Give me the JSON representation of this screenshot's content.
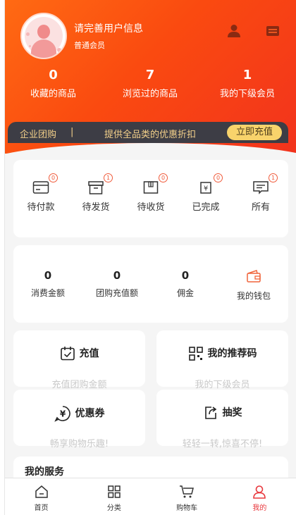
{
  "header": {
    "user_name": "请完善用户信息",
    "member_level": "普通会员",
    "icons": [
      "user-icon",
      "message-icon"
    ],
    "gradient_colors": [
      "#ff6a13",
      "#f2331d"
    ]
  },
  "stats": [
    {
      "value": "0",
      "label": "收藏的商品"
    },
    {
      "value": "7",
      "label": "浏览过的商品"
    },
    {
      "value": "1",
      "label": "我的下级会员"
    }
  ],
  "banner": {
    "left": "企业团购",
    "separator": "|",
    "text": "提供全品类的优惠折扣",
    "button": "立即充值"
  },
  "orders": [
    {
      "label": "待付款",
      "badge": "0",
      "icon": "wallet-card-icon"
    },
    {
      "label": "待发货",
      "badge": "1",
      "icon": "box-icon"
    },
    {
      "label": "待收货",
      "badge": "0",
      "icon": "package-icon"
    },
    {
      "label": "已完成",
      "badge": "0",
      "icon": "yen-receipt-icon"
    },
    {
      "label": "所有",
      "badge": "1",
      "icon": "list-icon"
    }
  ],
  "wallet": [
    {
      "value": "0",
      "label": "消费金额"
    },
    {
      "value": "0",
      "label": "团购充值额"
    },
    {
      "value": "0",
      "label": "佣金"
    },
    {
      "value": "",
      "label": "我的钱包",
      "icon": "wallet-icon"
    }
  ],
  "tiles": [
    {
      "title": "充值",
      "subtitle": "充值团购金额",
      "icon": "calendar-check-icon"
    },
    {
      "title": "我的推荐码",
      "subtitle": "我的下级会员",
      "icon": "qrcode-icon"
    },
    {
      "title": "优惠券",
      "subtitle": "畅享购物乐趣!",
      "icon": "yen-coupon-icon"
    },
    {
      "title": "抽奖",
      "subtitle": "轻轻一转,惊喜不停!",
      "icon": "share-box-icon"
    }
  ],
  "services": {
    "title": "我的服务"
  },
  "tabbar": [
    {
      "label": "首页",
      "icon": "home-icon"
    },
    {
      "label": "分类",
      "icon": "grid-icon"
    },
    {
      "label": "购物车",
      "icon": "cart-icon"
    },
    {
      "label": "我的",
      "icon": "person-icon",
      "active": true
    }
  ],
  "colors": {
    "accent": "#e8383d",
    "banner_bg": "#3d3d45",
    "banner_text": "#f3d08a",
    "button_bg": "#f8d36b"
  }
}
